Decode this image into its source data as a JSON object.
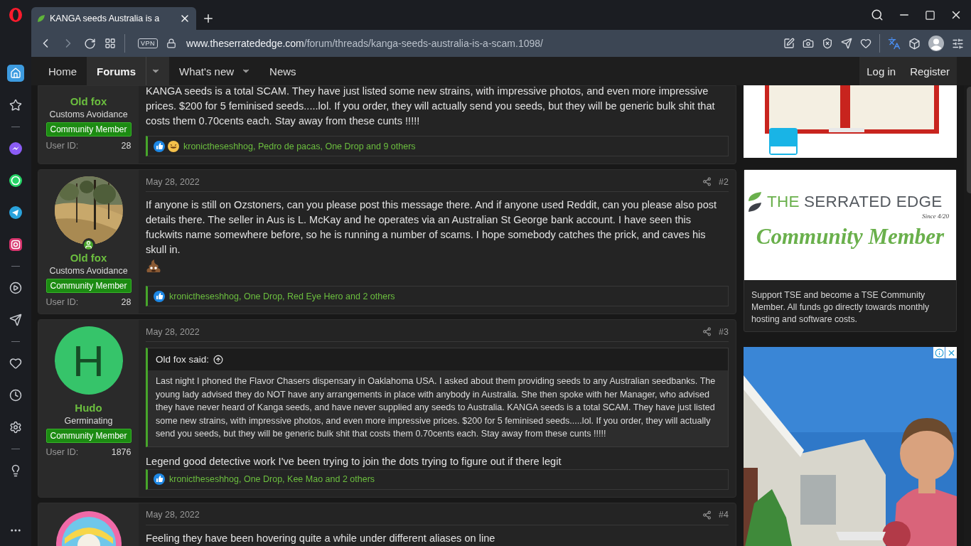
{
  "browser": {
    "tab": {
      "title": "KANGA seeds Australia is a"
    },
    "vpn_badge": "VPN",
    "url": {
      "domain": "www.theserratededge.com",
      "path": "/forum/threads/kanga-seeds-australia-is-a-scam.1098/"
    }
  },
  "sidebar": {
    "items": [
      {
        "kind": "home",
        "selected": true
      },
      {
        "kind": "star",
        "selected": false
      },
      {
        "kind": "divider"
      },
      {
        "kind": "messenger",
        "selected": false
      },
      {
        "kind": "whatsapp",
        "selected": false
      },
      {
        "kind": "telegram",
        "selected": false
      },
      {
        "kind": "instagram",
        "selected": false
      },
      {
        "kind": "divider"
      },
      {
        "kind": "player",
        "selected": false
      },
      {
        "kind": "send",
        "selected": false
      },
      {
        "kind": "divider"
      },
      {
        "kind": "heart",
        "selected": false
      },
      {
        "kind": "history",
        "selected": false
      },
      {
        "kind": "settings",
        "selected": false
      },
      {
        "kind": "divider"
      },
      {
        "kind": "tips",
        "selected": false
      },
      {
        "kind": "more",
        "selected": false
      }
    ]
  },
  "nav": {
    "items": [
      {
        "label": "Home",
        "selected": false,
        "dropdown": false
      },
      {
        "label": "Forums",
        "selected": true,
        "dropdown": true
      },
      {
        "label": "What's new",
        "selected": false,
        "dropdown": true
      },
      {
        "label": "News",
        "selected": false,
        "dropdown": false
      }
    ],
    "account": [
      "Log in",
      "Register"
    ]
  },
  "posts": [
    {
      "user": {
        "name": "Old fox",
        "title": "Customs Avoidance",
        "badge": "Community Member",
        "id_label": "User ID:",
        "id": "28"
      },
      "body": "KANGA seeds is a total SCAM. They have just listed some new strains, with impressive photos, and even more impressive prices. $200 for 5 feminised seeds.....lol. If you order, they will actually send you seeds, but they will be generic bulk shit that costs them 0.70cents each. Stay away from these cunts !!!!!",
      "reactions": {
        "icons": [
          {
            "kind": "like"
          },
          {
            "kind": "laugh"
          }
        ],
        "text": "kronictheseshhog, Pedro de pacas, One Drop and 9 others"
      }
    },
    {
      "user": {
        "online": true,
        "name": "Old fox",
        "title": "Customs Avoidance",
        "badge": "Community Member",
        "id_label": "User ID:",
        "id": "28"
      },
      "date": "May 28, 2022",
      "number": "#2",
      "body": "If anyone is still on Ozstoners, can you please post this message there. And if anyone used Reddit, can you please also post details there. The seller in Aus is L. McKay and he operates via an Australian St George bank account. I have seen this fuckwits name somewhere before, so he is running a number of scams. I hope somebody catches the prick, and caves his skull in.",
      "emoji": {
        "kind": "poop"
      },
      "reactions": {
        "icons": [
          {
            "kind": "like"
          }
        ],
        "text": "kronictheseshhog, One Drop, Red Eye Hero and 2 others"
      }
    },
    {
      "user": {
        "avatar": {
          "kind": "letter",
          "letter": "H",
          "color": "#36c46a"
        },
        "online": false,
        "name": "Hudo",
        "title": "Germinating",
        "badge": "Community Member",
        "id_label": "User ID:",
        "id": "1876"
      },
      "date": "May 28, 2022",
      "number": "#3",
      "quote": {
        "author": "Old fox said:",
        "text": "Last night I phoned the Flavor Chasers dispensary in Oaklahoma USA. I asked about them providing seeds to any Australian seedbanks. The young lady advised they do NOT have any arrangements in place with anybody in Australia. She then spoke with her Manager, who advised they have never heard of Kanga seeds, and have never supplied any seeds to Australia. KANGA seeds is a total SCAM. They have just listed some new strains, with impressive photos, and even more impressive prices. $200 for 5 feminised seeds.....lol. If you order, they will actually send you seeds, but they will be generic bulk shit that costs them 0.70cents each. Stay away from these cunts !!!!!"
      },
      "body": "Legend good detective work I've been trying to join the dots trying to figure out if there legit",
      "reactions": {
        "icons": [
          {
            "kind": "like"
          }
        ],
        "text": "kronictheseshhog, One Drop, Kee Mao and 2 others"
      }
    },
    {
      "user": {
        "avatar": {
          "kind": "logo"
        }
      },
      "date": "May 28, 2022",
      "number": "#4",
      "body": "Feeling they have been hovering quite a while under different aliases on line"
    }
  ],
  "widgets": {
    "membership": {
      "brand_accent": "THE",
      "brand": "SERRATED EDGE",
      "since": "Since 4/20",
      "title": "Community Member",
      "text": "Support TSE and become a TSE Community Member. All funds go directly towards monthly hosting and software costs."
    }
  }
}
